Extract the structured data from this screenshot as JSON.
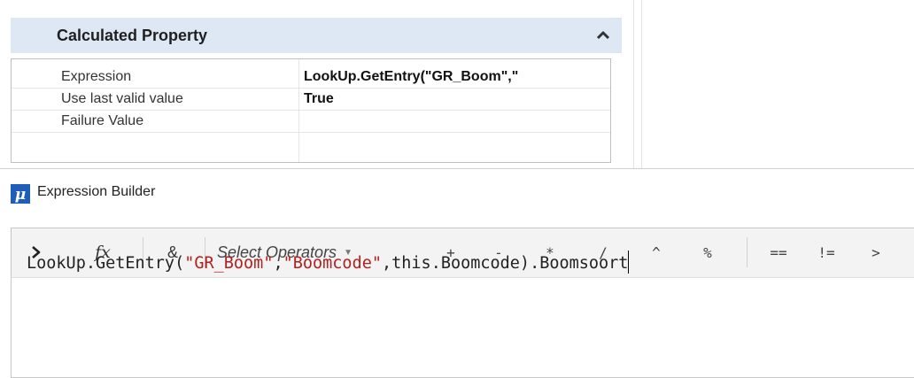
{
  "properties": {
    "section_title": "Calculated Property",
    "rows": [
      {
        "name": "Expression",
        "value": "LookUp.GetEntry(\"GR_Boom\",\""
      },
      {
        "name": "Use last valid value",
        "value": "True"
      },
      {
        "name": "Failure Value",
        "value": ""
      }
    ]
  },
  "builder": {
    "title": "Expression Builder",
    "toolbar": {
      "run_glyph": "❯",
      "fx_label": "fx",
      "concat_label": "&",
      "select_operators": "Select Operators",
      "operators": [
        "+",
        "-",
        "*",
        "/",
        "^",
        "%",
        "==",
        "!=",
        ">"
      ]
    },
    "expression": {
      "part1": "LookUp.GetEntry(",
      "str1": "\"GR_Boom\"",
      "part2": ",",
      "str2": "\"Boomcode\"",
      "part3": ",this.Boomcode).Boomsoort"
    }
  },
  "icons": {
    "collapse": "chevron-up-icon",
    "logo": "mu-logo-icon",
    "run": "chevron-right-icon",
    "dropdown": "caret-down-icon"
  },
  "colors": {
    "header_bg": "#dde8f4",
    "string_literal": "#b3201e",
    "logo_blue": "#1d5fb8"
  }
}
